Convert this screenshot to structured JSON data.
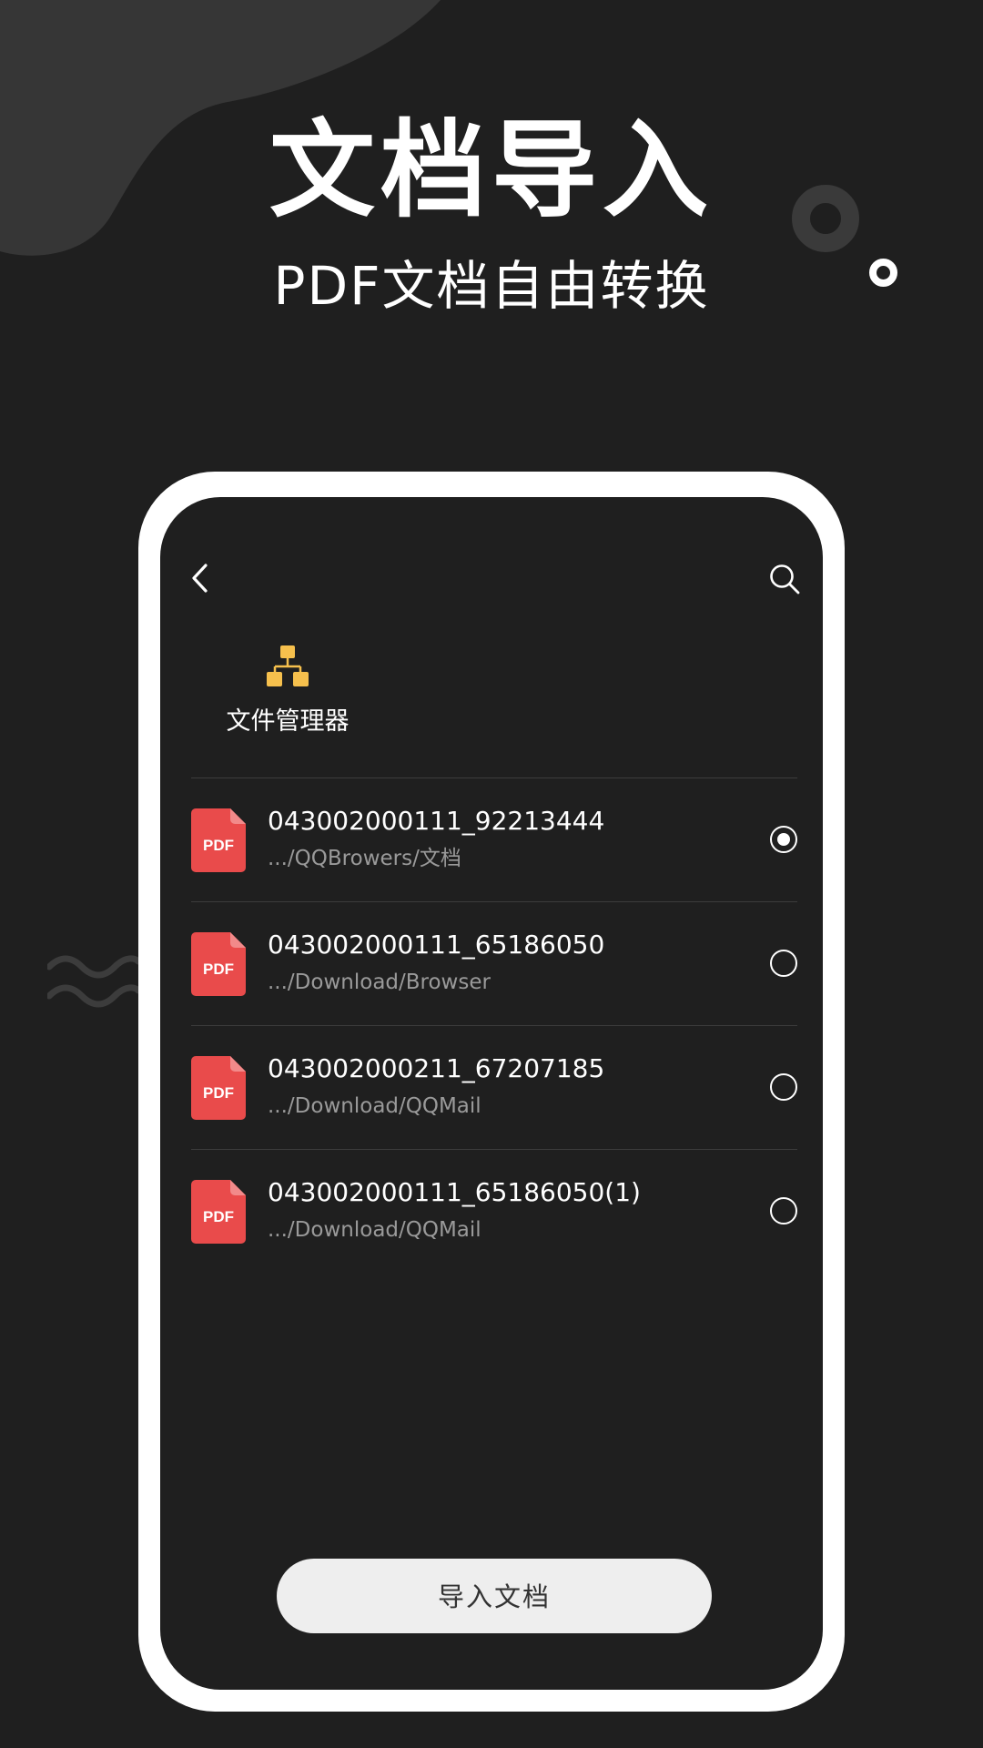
{
  "hero": {
    "title": "文档导入",
    "subtitle": "PDF文档自由转换"
  },
  "screen": {
    "file_manager_label": "文件管理器",
    "files": [
      {
        "name": "043002000111_92213444",
        "path": ".../QQBrowers/文档",
        "selected": true
      },
      {
        "name": "043002000111_65186050",
        "path": ".../Download/Browser",
        "selected": false
      },
      {
        "name": "043002000211_67207185",
        "path": ".../Download/QQMail",
        "selected": false
      },
      {
        "name": "043002000111_65186050(1)",
        "path": ".../Download/QQMail",
        "selected": false
      }
    ],
    "pdf_icon_text": "PDF",
    "import_button_label": "导入文档"
  },
  "colors": {
    "background": "#1f1f1f",
    "pdf_red": "#e94b4b",
    "folder_yellow": "#f6c04d",
    "button_bg": "#eeeeee"
  },
  "icons": [
    "back-arrow-icon",
    "search-icon",
    "file-tree-icon",
    "pdf-file-icon",
    "radio-button"
  ]
}
